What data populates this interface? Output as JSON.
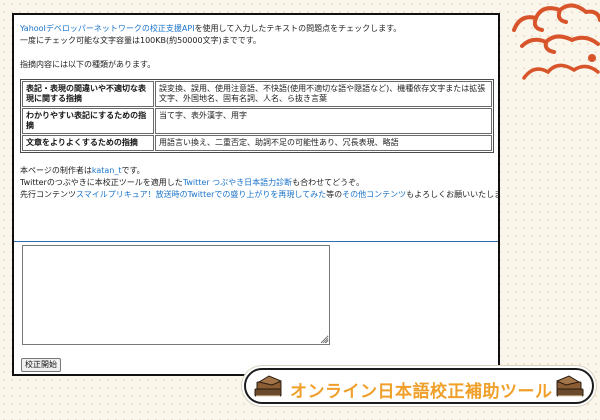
{
  "intro": {
    "line1_link": "YahooIデベロッパーネットワークの校正支援API",
    "line1_rest": "を使用して入力したテキストの問題点をチェックします。",
    "line2": "一度にチェック可能な文字容量は100KB(約50000文字)までです。",
    "line3": "指摘内容には以下の種類があります。"
  },
  "kinds": [
    {
      "name": "表記・表現の間違いや不適切な表現に関する指摘",
      "detail": "誤変換、誤用、使用注意語、不快語(使用不適切な語や隠語など)、機種依存文字または拡張文字、外国地名、固有名詞、人名、ら抜き言葉"
    },
    {
      "name": "わかりやすい表記にするための指摘",
      "detail": "当て字、表外漢字、用字"
    },
    {
      "name": "文章をよりよくするための指摘",
      "detail": "用語言い換え、二重否定、助詞不足の可能性あり、冗長表現、略語"
    }
  ],
  "credits": {
    "author_prefix": "本ページの制作者は",
    "author_link": "katan_t",
    "author_suffix": "です。",
    "twitter_prefix": "Twitterのつぶやきに本校正ツールを適用した",
    "twitter_link": "Twitter つぶやき日本語力診断",
    "twitter_suffix": "も合わせてどうぞ。",
    "more_prefix": "先行コンテンツ",
    "more_link1": "スマイルプリキュア！放送時のTwitterでの盛り上がりを再現してみた",
    "more_middle": "等の",
    "more_link2": "その他コンテンツ",
    "more_suffix": "もよろしくお願いいたします。"
  },
  "editor": {
    "value": ""
  },
  "submit_label": "校正開始",
  "banner": {
    "title": "オンライン日本語校正補助ツール"
  },
  "colors": {
    "link": "#1a73c9",
    "banner_text": "#f0a02a",
    "cloud": "#d8552b",
    "background": "#fbf6ec"
  }
}
